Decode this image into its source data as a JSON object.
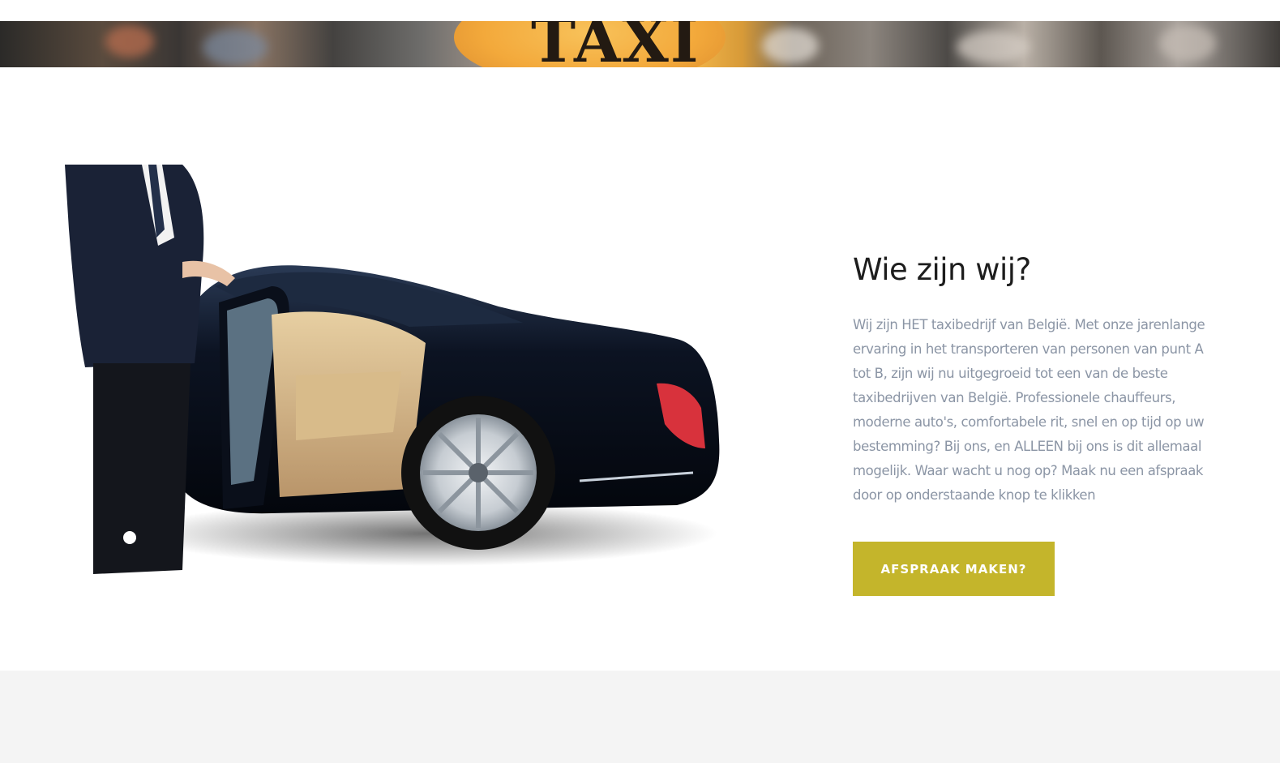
{
  "hero": {
    "sign_text": "TAXI"
  },
  "about": {
    "heading": "Wie zijn wij?",
    "body": "Wij zijn HET taxibedrijf van België. Met onze jarenlange ervaring in het transporteren van personen van punt A tot B, zijn wij nu uitgegroeid tot een van de beste taxibedrijven van België. Professionele chauffeurs, moderne auto's, comfortabele rit, snel en op tijd op uw bestemming? Bij ons, en ALLEEN bij ons is dit allemaal mogelijk. Waar wacht u nog op? Maak nu een afspraak door op onderstaande knop te klikken",
    "cta_label": "AFSPRAAK MAKEN?"
  },
  "colors": {
    "accent": "#c4b52b",
    "heading": "#1d1d1d",
    "body_text": "#8b95a5",
    "footer_band": "#f4f4f4"
  }
}
